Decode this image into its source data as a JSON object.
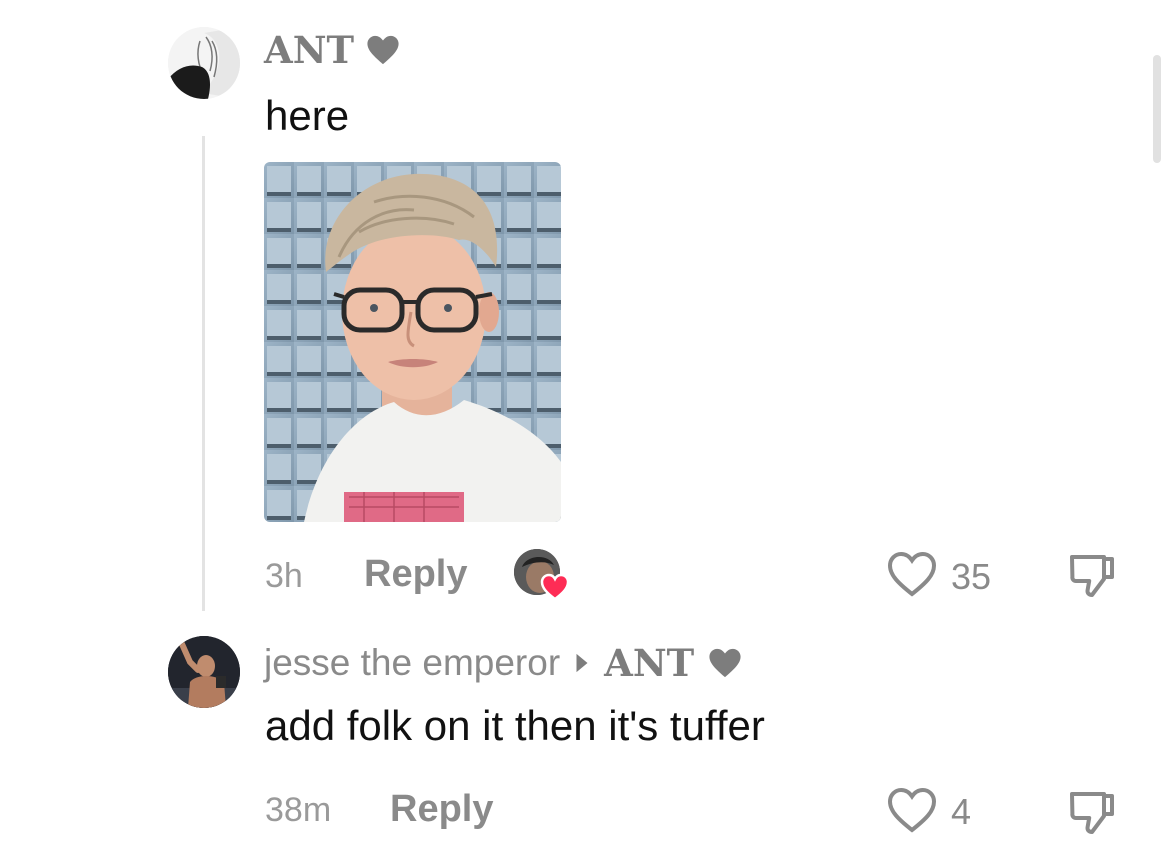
{
  "comments": [
    {
      "username": "ANT",
      "text": "here",
      "time": "3h",
      "reply_label": "Reply",
      "likes": "35",
      "has_image": true,
      "creator_liked": true
    },
    {
      "username": "jesse the emperor",
      "reply_to": "ANT",
      "text": "add folk on it then it's tuffer",
      "time": "38m",
      "reply_label": "Reply",
      "likes": "4"
    }
  ],
  "icons": {
    "username_badge": "heart-icon",
    "like": "heart-outline-icon",
    "dislike": "thumbs-down-outline-icon",
    "reply_arrow": "triangle-right-icon",
    "creator_like": "heart-filled-icon"
  },
  "colors": {
    "creator_heart": "#fe2c55",
    "muted_text": "#8a8a8a"
  }
}
